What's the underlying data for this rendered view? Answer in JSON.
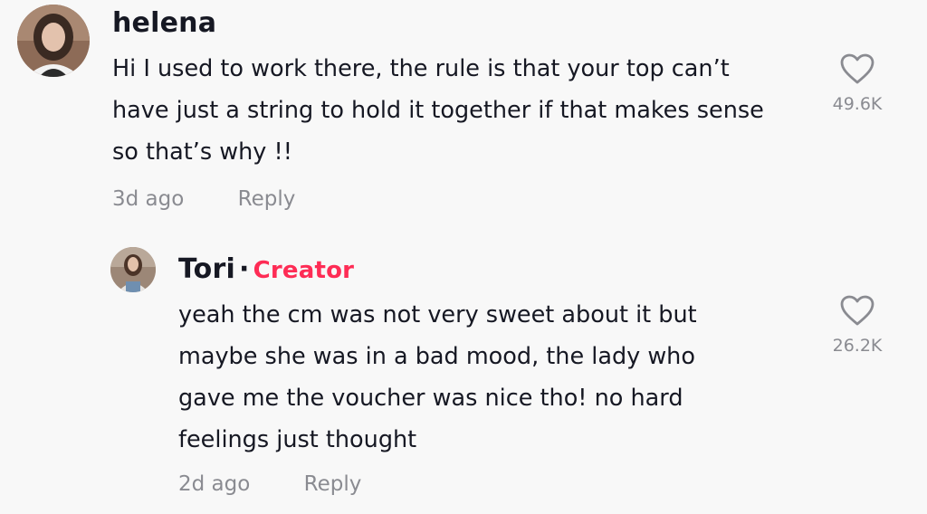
{
  "comments": [
    {
      "username": "helena",
      "text": "Hi I used to work there, the rule is that your top can’t have just a string to hold it together if that makes sense so that’s why !!",
      "time": "3d ago",
      "reply_label": "Reply",
      "likes": "49.6K",
      "icons": {
        "like": "heart-outline-icon",
        "avatar": "avatar"
      }
    },
    {
      "username": "Tori",
      "separator": "·",
      "badge": "Creator",
      "text": "yeah the cm was not very sweet about it but maybe she was in a bad mood, the lady who gave me the voucher was nice tho! no hard feelings just thought",
      "time": "2d ago",
      "reply_label": "Reply",
      "likes": "26.2K",
      "icons": {
        "like": "heart-outline-icon",
        "avatar": "avatar"
      }
    }
  ],
  "colors": {
    "background": "#f8f8f8",
    "text": "#161823",
    "muted": "#8a8b91",
    "creator_badge": "#fe2c55"
  }
}
